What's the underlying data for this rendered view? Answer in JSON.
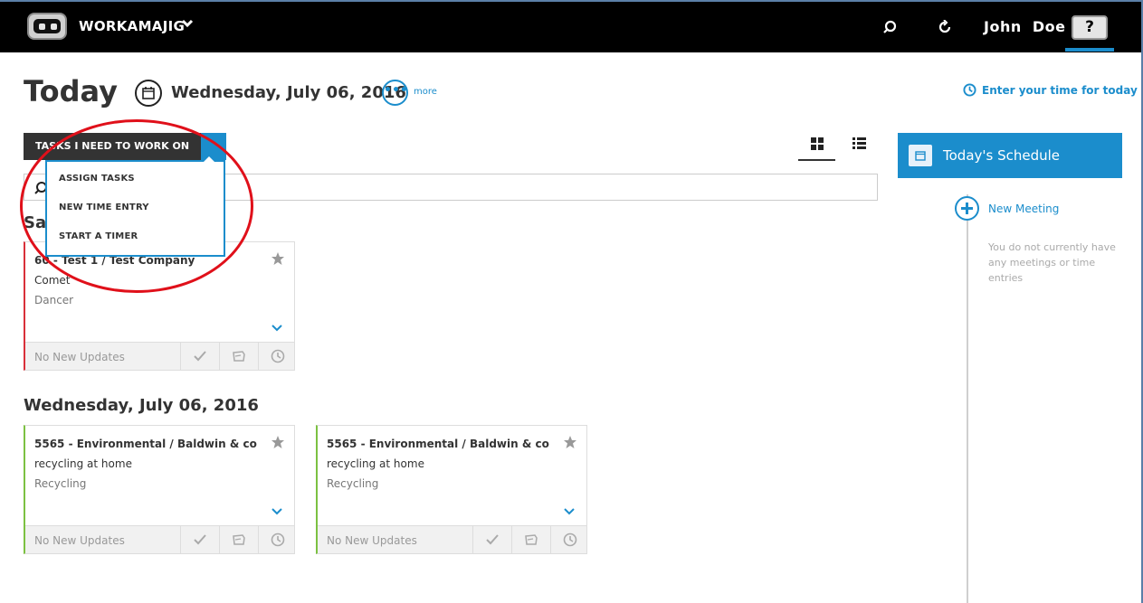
{
  "app": {
    "brand": "WORKAMAJIG",
    "user_name": "John  Doe",
    "help_label": "?"
  },
  "header": {
    "page_title": "Today",
    "date": "Wednesday, July 06, 2016",
    "more_label": "more",
    "enter_time_label": "Enter your time for today"
  },
  "tasks": {
    "button_label": "TASKS I NEED TO WORK ON",
    "menu": [
      "ASSIGN TASKS",
      "NEW TIME ENTRY",
      "START A TIMER"
    ],
    "search_placeholder": ""
  },
  "groups": [
    {
      "heading": "Sat",
      "cards": [
        {
          "title": "60 - Test 1 / Test Company",
          "subtitle": "Comet",
          "category": "Dancer",
          "updates": "No New Updates",
          "accent": "#d9303a"
        }
      ]
    },
    {
      "heading": "Wednesday, July 06, 2016",
      "cards": [
        {
          "title": "5565 - Environmental / Baldwin & co",
          "subtitle": "recycling at home",
          "category": "Recycling",
          "updates": "No New Updates",
          "accent": "#7cc142"
        },
        {
          "title": "5565 - Environmental / Baldwin & co",
          "subtitle": "recycling at home",
          "category": "Recycling",
          "updates": "No New Updates",
          "accent": "#7cc142"
        }
      ]
    }
  ],
  "schedule": {
    "title": "Today's Schedule",
    "new_meeting_label": "New Meeting",
    "empty_text": "You do not currently have any meetings or time entries"
  },
  "colors": {
    "accent_blue": "#1b8dcc",
    "topbar": "#000000",
    "annotation_red": "#e0101a"
  }
}
